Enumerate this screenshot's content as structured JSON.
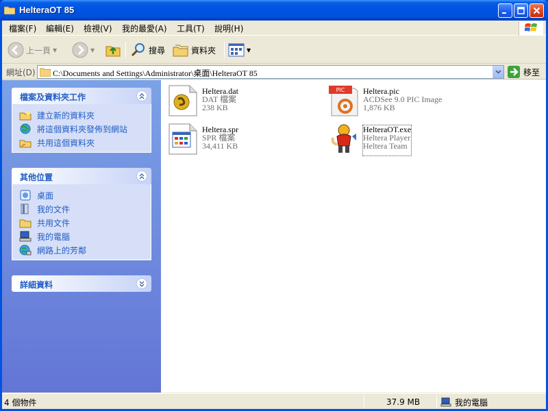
{
  "window": {
    "title": "HelteraOT 85"
  },
  "menu": [
    "檔案(F)",
    "編輯(E)",
    "檢視(V)",
    "我的最愛(A)",
    "工具(T)",
    "說明(H)"
  ],
  "toolbar": {
    "back_label": "上一頁",
    "search_label": "搜尋",
    "folders_label": "資料夾"
  },
  "address": {
    "label": "網址(D)",
    "path": "C:\\Documents and Settings\\Administrator\\桌面\\HelteraOT 85",
    "go_label": "移至"
  },
  "taskpane": {
    "file_tasks": {
      "title": "檔案及資料夾工作",
      "links": [
        "建立新的資料夾",
        "將這個資料夾發佈到網站",
        "共用這個資料夾"
      ]
    },
    "other_places": {
      "title": "其他位置",
      "links": [
        "桌面",
        "我的文件",
        "共用文件",
        "我的電腦",
        "網路上的芳鄰"
      ]
    },
    "details": {
      "title": "詳細資料"
    }
  },
  "files": [
    {
      "name": "Heltera.dat",
      "type": "DAT 檔案",
      "size": "238 KB",
      "icon": "dat-file-icon"
    },
    {
      "name": "Heltera.pic",
      "type": "ACDSee 9.0 PIC Image",
      "size": "1,876 KB",
      "icon": "pic-image-icon",
      "badge": "PIC"
    },
    {
      "name": "Heltera.spr",
      "type": "SPR 檔案",
      "size": "34,411 KB",
      "icon": "spr-file-icon"
    },
    {
      "name": "HelteraOT.exe",
      "type": "Heltera Player",
      "size": "Heltera Team",
      "icon": "heltera-player-icon"
    }
  ],
  "status": {
    "items": "4 個物件",
    "size": "37.9 MB",
    "location": "我的電腦"
  },
  "colors": {
    "title_bar": "#0054e3",
    "task_link": "#215dc6",
    "pane_bg": "#7ba2e7"
  }
}
